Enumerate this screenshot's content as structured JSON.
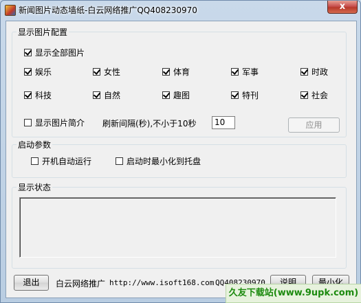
{
  "window": {
    "title": "新闻图片动态墙纸-白云网络推广QQ408230970",
    "close_glyph": "x"
  },
  "display_config": {
    "legend": "显示图片配置",
    "show_all": {
      "label": "显示全部图片",
      "checked": true
    },
    "categories_row1": [
      {
        "label": "娱乐",
        "checked": true
      },
      {
        "label": "女性",
        "checked": true
      },
      {
        "label": "体育",
        "checked": true
      },
      {
        "label": "军事",
        "checked": true
      },
      {
        "label": "时政",
        "checked": true
      }
    ],
    "categories_row2": [
      {
        "label": "科技",
        "checked": true
      },
      {
        "label": "自然",
        "checked": true
      },
      {
        "label": "趣图",
        "checked": true
      },
      {
        "label": "特刊",
        "checked": true
      },
      {
        "label": "社会",
        "checked": true
      }
    ],
    "show_summary": {
      "label": "显示图片简介",
      "checked": false
    },
    "interval_label": "刷新间隔(秒),不小于10秒",
    "interval_value": "10",
    "apply_label": "应用"
  },
  "startup": {
    "legend": "启动参数",
    "autorun": {
      "label": "开机自动运行",
      "checked": false
    },
    "minimize_tray": {
      "label": "启动时最小化到托盘",
      "checked": false
    }
  },
  "status": {
    "legend": "显示状态",
    "content": ""
  },
  "footer": {
    "exit_label": "退出",
    "promo_text": "白云网络推广",
    "url": "http://www.isoft168.com",
    "qq": "QQ408230970",
    "help_label": "说明",
    "minimize_label": "最小化"
  },
  "watermark": "久友下载站(www.9upk.com)"
}
